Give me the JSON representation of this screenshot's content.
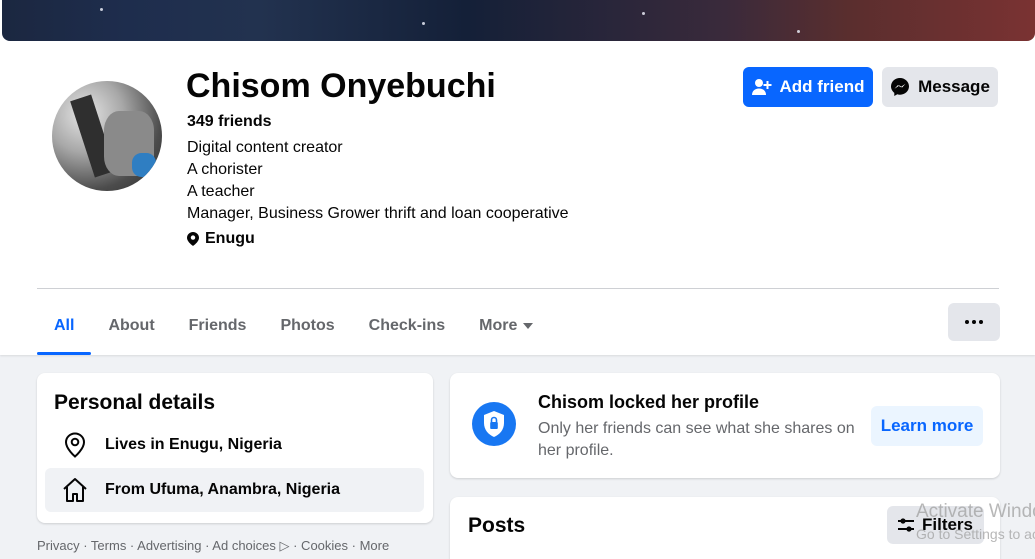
{
  "profile": {
    "name": "Chisom Onyebuchi",
    "friends": "349 friends",
    "bio": [
      "Digital content creator",
      "A chorister",
      "A teacher",
      "Manager, Business Grower thrift and loan cooperative"
    ],
    "location": "Enugu"
  },
  "actions": {
    "add_friend": "Add friend",
    "message": "Message"
  },
  "tabs": [
    {
      "label": "All",
      "active": true
    },
    {
      "label": "About"
    },
    {
      "label": "Friends"
    },
    {
      "label": "Photos"
    },
    {
      "label": "Check-ins"
    },
    {
      "label": "More"
    }
  ],
  "personal_details": {
    "title": "Personal details",
    "lives_in": "Lives in Enugu, Nigeria",
    "from": "From Ufuma, Anambra, Nigeria"
  },
  "locked": {
    "title": "Chisom locked her profile",
    "desc": "Only her friends can see what she shares on her profile.",
    "button": "Learn more"
  },
  "posts": {
    "title": "Posts",
    "filters": "Filters"
  },
  "footer": {
    "text": "Privacy · Terms · Advertising · Ad choices ▷ · Cookies · More"
  },
  "watermark": {
    "line1": "Activate Windows",
    "line2": "Go to Settings to activate Windows."
  },
  "colors": {
    "primary": "#0866ff",
    "lock_icon": "#1877f2",
    "background": "#f0f2f5"
  },
  "icons": [
    "user-plus-icon",
    "messenger-icon",
    "map-pin-icon",
    "chevron-down-icon",
    "more-dots-icon",
    "location-pin-icon",
    "home-icon",
    "shield-lock-icon",
    "filters-icon"
  ]
}
